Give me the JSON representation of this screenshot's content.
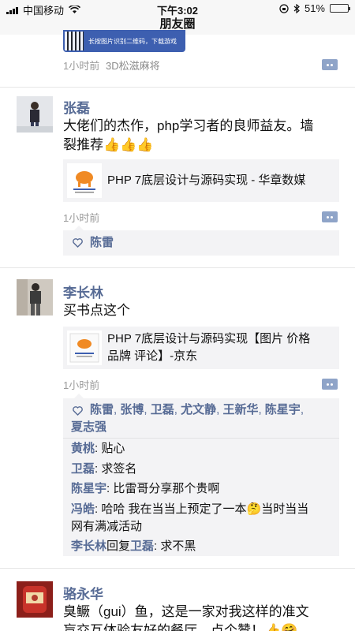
{
  "status_bar": {
    "carrier": "中国移动",
    "time": "下午3:02",
    "battery": "51%",
    "battery_level": 0.51
  },
  "nav": {
    "title": "朋友圈"
  },
  "top_post": {
    "ad_text": "长按图片识别二维码，下载游戏",
    "time": "1小时前",
    "source": "3D松滋麻将"
  },
  "posts": [
    {
      "name": "张磊",
      "text_line1": "大佬们的杰作，php学习者的良师益友。墙",
      "text_line2": "裂推荐👍👍👍",
      "link_title": "PHP 7底层设计与源码实现 - 华章数媒",
      "time": "1小时前",
      "likes": [
        "陈雷"
      ]
    },
    {
      "name": "李长林",
      "text": "买书点这个",
      "link_title_line1": "PHP 7底层设计与源码实现【图片 价格",
      "link_title_line2": "品牌 评论】-京东",
      "time": "1小时前",
      "likes": [
        "陈雷",
        "张博",
        "卫磊",
        "尤文静",
        "王新华",
        "陈星宇",
        "夏志强"
      ],
      "comments": [
        {
          "who": "黄桃",
          "text": "贴心"
        },
        {
          "who": "卫磊",
          "text": "求签名"
        },
        {
          "who": "陈星宇",
          "text": "比雷哥分享那个贵啊"
        },
        {
          "who": "冯皓",
          "text_line1": "哈哈 我在当当上预定了一本🤔当时当当",
          "text_line2": "网有满减活动"
        },
        {
          "who": "李长林",
          "reply_word": "回复",
          "to": "卫磊",
          "text": "求不黑"
        }
      ]
    },
    {
      "name": "骆永华",
      "text_line1": "臭鳜（gui）鱼，这是一家对我这样的准文",
      "text_line2": "盲交互体验友好的餐厅，点个赞！👍🤗"
    }
  ]
}
